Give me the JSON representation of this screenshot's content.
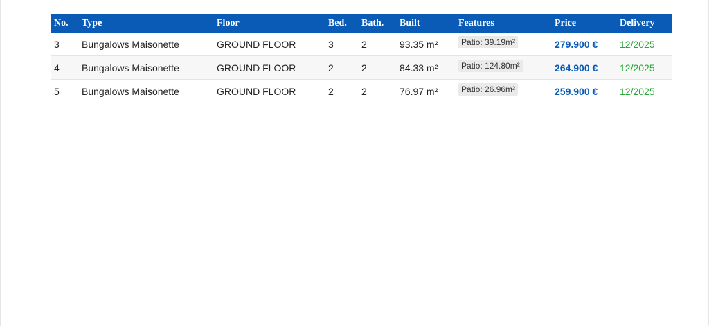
{
  "table": {
    "headers": [
      "No.",
      "Type",
      "Floor",
      "Bed.",
      "Bath.",
      "Built",
      "Features",
      "Price",
      "Delivery"
    ],
    "rows": [
      {
        "no": "3",
        "type": "Bungalows Maisonette",
        "floor": "GROUND FLOOR",
        "bed": "3",
        "bath": "2",
        "built": "93.35 m²",
        "features": "Patio: 39.19m²",
        "price": "279.900 €",
        "delivery": "12/2025"
      },
      {
        "no": "4",
        "type": "Bungalows Maisonette",
        "floor": "GROUND FLOOR",
        "bed": "2",
        "bath": "2",
        "built": "84.33 m²",
        "features": "Patio: 124.80m²",
        "price": "264.900 €",
        "delivery": "12/2025"
      },
      {
        "no": "5",
        "type": "Bungalows Maisonette",
        "floor": "GROUND FLOOR",
        "bed": "2",
        "bath": "2",
        "built": "76.97 m²",
        "features": "Patio: 26.96m²",
        "price": "259.900 €",
        "delivery": "12/2025"
      }
    ]
  },
  "colors": {
    "header_background": "#0a5bb5",
    "price_text": "#0a5bb5",
    "delivery_text": "#2aa53a"
  }
}
